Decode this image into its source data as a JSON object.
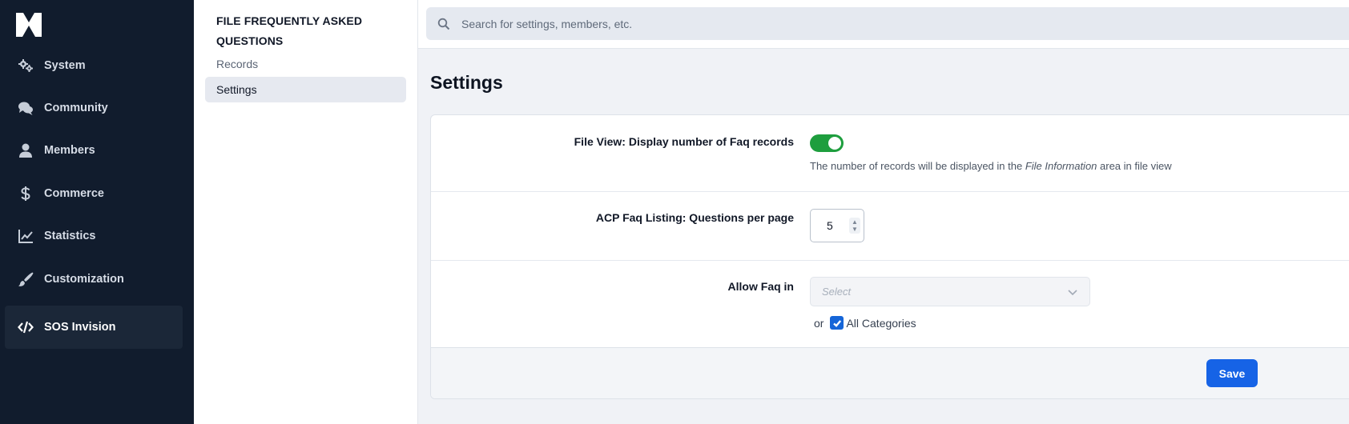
{
  "nav": {
    "logo_icon": "brand-logo-icon",
    "items": [
      {
        "label": "System",
        "icon": "gears-icon"
      },
      {
        "label": "Community",
        "icon": "chat-bubbles-icon"
      },
      {
        "label": "Members",
        "icon": "user-icon"
      },
      {
        "label": "Commerce",
        "icon": "dollar-icon"
      },
      {
        "label": "Statistics",
        "icon": "line-chart-icon"
      },
      {
        "label": "Customization",
        "icon": "paintbrush-icon"
      },
      {
        "label": "SOS Invision",
        "icon": "code-icon",
        "active": true
      }
    ]
  },
  "submenu": {
    "title": "FILE FREQUENTLY ASKED QUESTIONS",
    "items": [
      {
        "label": "Records"
      },
      {
        "label": "Settings",
        "active": true
      }
    ]
  },
  "search": {
    "placeholder": "Search for settings, members, etc.",
    "value": ""
  },
  "page": {
    "title": "Settings"
  },
  "settings": {
    "file_view": {
      "label": "File View: Display number of Faq records",
      "enabled": true,
      "desc_before": "The number of records will be displayed in the ",
      "desc_em": "File Information",
      "desc_after": " area in file view"
    },
    "acp_listing": {
      "label": "ACP Faq Listing: Questions per page",
      "value": "5"
    },
    "allow_faq": {
      "label": "Allow Faq in",
      "select_placeholder": "Select",
      "or_text": "or",
      "all_categories_label": "All Categories",
      "all_categories_checked": true
    }
  },
  "footer": {
    "save_label": "Save"
  },
  "colors": {
    "nav_bg": "#111c2d",
    "accent": "#1663e6",
    "toggle_on": "#1e9e3e"
  }
}
